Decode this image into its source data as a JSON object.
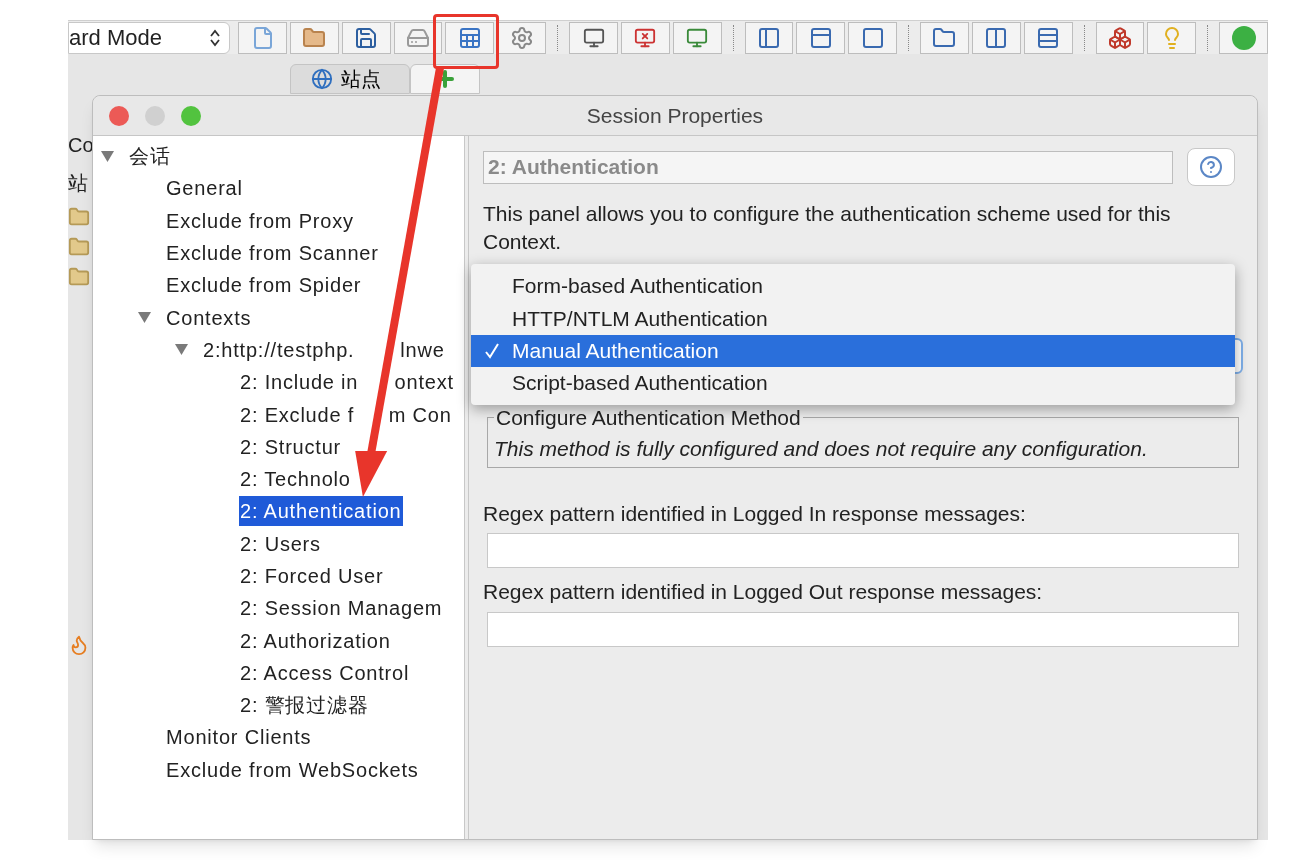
{
  "toolbar": {
    "mode_select": {
      "value": "ard Mode"
    }
  },
  "tabs": [
    {
      "label": "站点",
      "selected": true
    }
  ],
  "left_strip": {
    "labels": [
      "Co",
      "站"
    ]
  },
  "dialog": {
    "title": "Session Properties",
    "tree": [
      {
        "label": "会话",
        "expanded": true,
        "selected": false,
        "children": [
          {
            "label": "General",
            "selected": false
          },
          {
            "label": "Exclude from Proxy",
            "selected": false
          },
          {
            "label": "Exclude from Scanner",
            "selected": false
          },
          {
            "label": "Exclude from Spider",
            "selected": false
          },
          {
            "label": "Contexts",
            "expanded": true,
            "selected": false,
            "children": [
              {
                "label": "2:http://testphp.",
                "tail": "lnwe",
                "expanded": true,
                "selected": false,
                "children": [
                  {
                    "label": "2: Include in",
                    "tail": "ontext",
                    "selected": false
                  },
                  {
                    "label": "2: Exclude f",
                    "tail": "m Con",
                    "selected": false
                  },
                  {
                    "label": "2: Structur",
                    "selected": false
                  },
                  {
                    "label": "2: Technolo",
                    "selected": false
                  },
                  {
                    "label": "2: Authentication",
                    "selected": true
                  },
                  {
                    "label": "2: Users",
                    "selected": false
                  },
                  {
                    "label": "2: Forced User",
                    "selected": false
                  },
                  {
                    "label": "2: Session Managem",
                    "selected": false
                  },
                  {
                    "label": "2: Authorization",
                    "selected": false
                  },
                  {
                    "label": "2: Access Control",
                    "selected": false
                  },
                  {
                    "label": "2: 警报过滤器",
                    "selected": false
                  }
                ]
              }
            ]
          },
          {
            "label": "Monitor Clients",
            "selected": false
          },
          {
            "label": "Exclude from WebSockets",
            "selected": false
          }
        ]
      }
    ],
    "panel": {
      "header": "2: Authentication",
      "description": "This panel allows you to configure the authentication scheme used for this Context.",
      "method_options": [
        {
          "label": "Form-based Authentication",
          "selected": false
        },
        {
          "label": "HTTP/NTLM Authentication",
          "selected": false
        },
        {
          "label": "Manual Authentication",
          "selected": true
        },
        {
          "label": "Script-based Authentication",
          "selected": false
        }
      ],
      "method_group": {
        "title": "Configure Authentication Method",
        "note": "This method is fully configured and does not require any configuration."
      },
      "fields": [
        {
          "label": "Regex pattern identified in Logged In response messages:"
        },
        {
          "label": "Regex pattern identified in Logged Out response messages:"
        }
      ]
    }
  }
}
